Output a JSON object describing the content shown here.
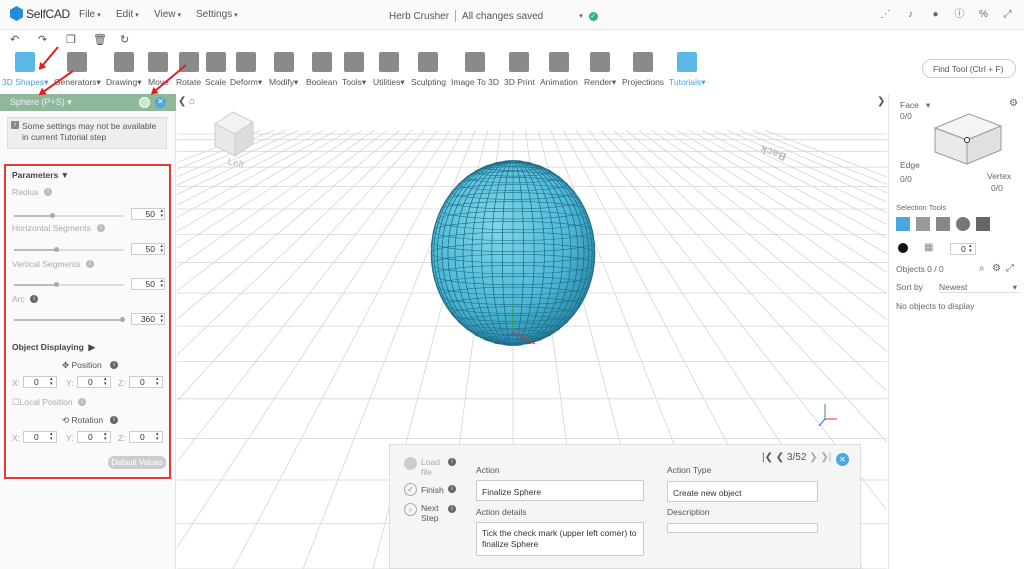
{
  "app": {
    "name": "SelfCAD"
  },
  "menu": {
    "file": "File",
    "edit": "Edit",
    "view": "View",
    "settings": "Settings"
  },
  "project": {
    "name": "Herb Crusher",
    "status": "All changes saved"
  },
  "tools": [
    {
      "label": "3D Shapes",
      "icon": "cube-icon",
      "selected": true
    },
    {
      "label": "Generators",
      "icon": "generator-icon"
    },
    {
      "label": "Drawing",
      "icon": "drawing-icon"
    },
    {
      "label": "Move",
      "icon": "move-icon"
    },
    {
      "label": "Rotate",
      "icon": "rotate-icon"
    },
    {
      "label": "Scale",
      "icon": "scale-icon"
    },
    {
      "label": "Deform",
      "icon": "deform-icon"
    },
    {
      "label": "Modify",
      "icon": "modify-icon"
    },
    {
      "label": "Boolean",
      "icon": "boolean-icon"
    },
    {
      "label": "Tools",
      "icon": "tools-icon"
    },
    {
      "label": "Utilities",
      "icon": "utilities-icon"
    },
    {
      "label": "Sculpting",
      "icon": "sculpting-icon"
    },
    {
      "label": "Image To 3D",
      "icon": "image-to-3d-icon"
    },
    {
      "label": "3D Print",
      "icon": "printer-icon"
    },
    {
      "label": "Animation",
      "icon": "animation-icon"
    },
    {
      "label": "Render",
      "icon": "render-icon"
    },
    {
      "label": "Projections",
      "icon": "projections-icon"
    },
    {
      "label": "Tutorials",
      "icon": "tutorials-icon",
      "highlight": true
    }
  ],
  "find_tool": "Find Tool (Ctrl + F)",
  "panel": {
    "title": "Sphere (P+S)",
    "notice": "Some settings may not be available in current Tutorial step",
    "parameters": "Parameters",
    "radius": {
      "label": "Radius",
      "value": "50",
      "fill": 0.35
    },
    "hseg": {
      "label": "Horizontal Segments",
      "value": "50",
      "fill": 0.38
    },
    "vseg": {
      "label": "Vertical Segments",
      "value": "50",
      "fill": 0.38
    },
    "arc": {
      "label": "Arc",
      "value": "360",
      "fill": 1.0
    },
    "object_displaying": "Object Displaying",
    "position": "Position",
    "local_position": "Local Position",
    "rotation": "Rotation",
    "x": "X:",
    "y": "Y:",
    "z": "Z:",
    "zero": "0",
    "default_values": "Default Values"
  },
  "viewcube": {
    "left": "Left",
    "back": "Back"
  },
  "right": {
    "face": "Face",
    "face_count": "0/0",
    "edge": "Edge",
    "edge_count": "0/0",
    "vertex": "Vertex",
    "vertex_count": "0/0",
    "selection_tools": "Selection Tools",
    "selection_value": "0",
    "objects": "Objects 0 / 0",
    "sort_by": "Sort by",
    "sort_value": "Newest",
    "no_objects": "No objects to display"
  },
  "tutorial": {
    "step_load": "Load file",
    "step_finish": "Finish",
    "step_next": "Next Step",
    "counter": "3/52",
    "action_label": "Action",
    "action_value": "Finalize Sphere",
    "details_label": "Action details",
    "details_value": "Tick the check mark (upper left corner) to finalize Sphere",
    "type_label": "Action Type",
    "type_value": "Create new object",
    "description_label": "Description"
  },
  "colors": {
    "accent": "#4aa8e0",
    "sphere": "#58c3dc",
    "highlight_box": "#e53935"
  }
}
